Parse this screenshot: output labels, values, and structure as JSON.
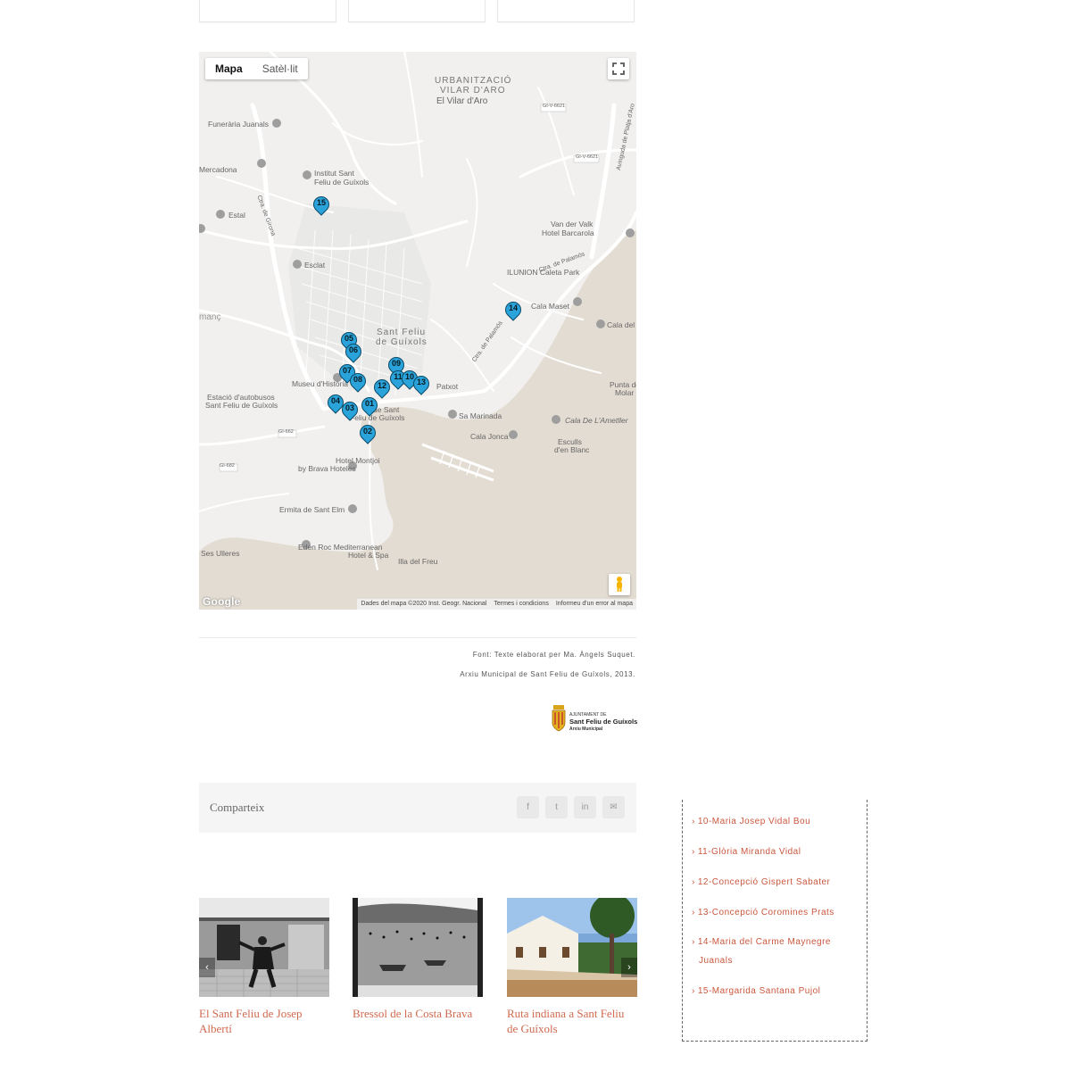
{
  "map": {
    "type_buttons": [
      "Mapa",
      "Satèl·lit"
    ],
    "attribution": [
      "Dades del mapa ©2020 Inst. Geogr. Nacional",
      "Termes i condicions",
      "Informeu d'un error al mapa"
    ],
    "logo": "Google",
    "labels": {
      "urb1": "URBANITZACIÓ",
      "urb2": "VILAR D'ARO",
      "vilar": "El Vilar d'Aro",
      "funeraria": "Funerària Juanals",
      "mercadona": "Mercadona",
      "institut1": "Institut Sant",
      "institut2": "Feliu de Guíxols",
      "estal": "Estal",
      "esclat": "Esclat",
      "manc": "manç",
      "vanderValk1": "Van der Valk",
      "vanderValk2": "Hotel Barcarola",
      "ilunion": "ILUNION Caleta Park",
      "calaMaset": "Cala Maset",
      "calaDel": "Cala del",
      "sfg1": "Sant Feliu",
      "sfg2": "de Guíxols",
      "museu": "Museu d'Història",
      "patxot": "Patxot",
      "estacio1": "Estació d'autobusos",
      "estacio2": "Sant Feliu de Guíxols",
      "ajunt1": "de Sant",
      "ajunt2": "Feliu de Guíxols",
      "marinada": "Sa Marinada",
      "puntaMolar1": "Punta de",
      "puntaMolar2": "Molar",
      "calaAmetller": "Cala De L'Ametller",
      "calaJonca": "Cala Jonca",
      "esculls1": "Esculls",
      "esculls2": "d'en Blanc",
      "montjoi1": "Hotel Montjoi",
      "montjoi2": "by Brava Hoteles",
      "ermita": "Ermita de Sant Elm",
      "edenroc1": "Eden Roc Mediterranean",
      "edenroc2": "Hotel & Spa",
      "illa": "Illa del Freu",
      "ulleres": "Ses Ulleres",
      "gi662": "GI-662",
      "gi662b": "GI-682",
      "giv6621": "GI-V-6621",
      "giv6621b": "GI-V-6621",
      "ctra": "Ctra. de Palamós",
      "ctra2": "Ctra. de Palamós",
      "avplatja": "Avinguda de Platja d'Aro",
      "ctraGirona": "Ctra. de Girona"
    },
    "markers": [
      "15",
      "14",
      "05",
      "06",
      "09",
      "07",
      "11",
      "10",
      "13",
      "08",
      "12",
      "04",
      "03",
      "01",
      "02"
    ]
  },
  "source": {
    "line1": "Font: Texte elaborat per Ma. Àngels Suquet.",
    "line2": "Arxiu Municipal de Sant Feliu de Guíxols, 2013."
  },
  "logo": {
    "line1": "AJUNTAMENT DE",
    "line2": "Sant Feliu de Guíxols",
    "line3": "Arxiu Municipal"
  },
  "share": {
    "label": "Comparteix",
    "icons": [
      "facebook-icon",
      "twitter-icon",
      "linkedin-icon",
      "email-icon"
    ],
    "glyphs": [
      "f",
      "t",
      "in",
      "✉"
    ]
  },
  "related": [
    {
      "title": "El Sant Feliu de Josep Albertí"
    },
    {
      "title": "Bressol de la Costa Brava"
    },
    {
      "title": "Ruta indiana a Sant Feliu de Guíxols"
    }
  ],
  "sidebar": {
    "items": [
      "10-Maria Josep Vidal Bou",
      "11-Glòria Miranda Vidal",
      "12-Concepció Gispert Sabater",
      "13-Concepció Coromines Prats",
      "14-Maria del Carme Maynegre",
      "Juanals",
      "15-Margarida Santana Pujol"
    ]
  },
  "colors": {
    "accent": "#c9573e",
    "marker": "#29a3d9"
  }
}
